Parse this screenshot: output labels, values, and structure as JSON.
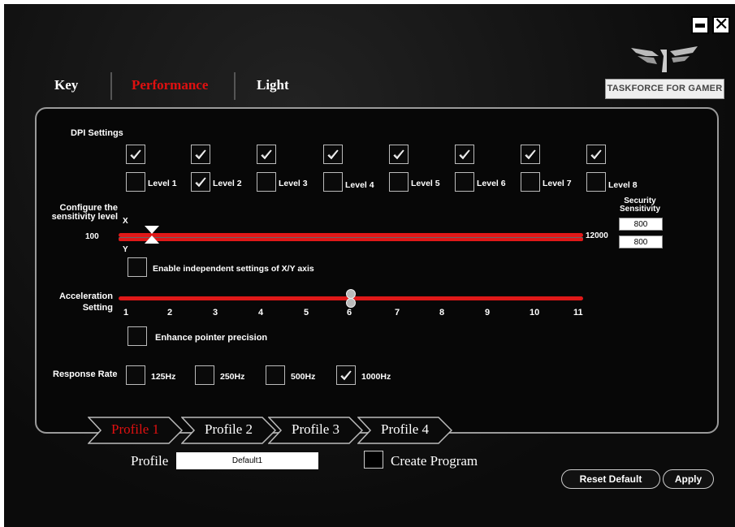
{
  "window_controls": {
    "minimize_icon": "minimize-icon",
    "close_label": "✕"
  },
  "tabs": [
    {
      "label": "Key"
    },
    {
      "label": "Performance"
    },
    {
      "label": "Light"
    }
  ],
  "brand": {
    "text": "TASKFORCE FOR GAMER"
  },
  "dpi": {
    "title": "DPI Settings",
    "enabled": [
      true,
      true,
      true,
      true,
      true,
      true,
      true,
      true
    ],
    "levels": [
      {
        "label": "Level 1",
        "selected": false
      },
      {
        "label": "Level 2",
        "selected": true
      },
      {
        "label": "Level 3",
        "selected": false
      },
      {
        "label": "Level 4",
        "selected": false
      },
      {
        "label": "Level 5",
        "selected": false
      },
      {
        "label": "Level 6",
        "selected": false
      },
      {
        "label": "Level 7",
        "selected": false
      },
      {
        "label": "Level 8",
        "selected": false
      }
    ]
  },
  "sensitivity": {
    "label_line1": "Configure the",
    "label_line2": "sensitivity level",
    "x_label": "X",
    "y_label": "Y",
    "min": "100",
    "max": "12000",
    "security_line1": "Security",
    "security_line2": "Sensitivity",
    "x_value": "800",
    "y_value": "800",
    "independent_label": "Enable independent settings  of X/Y axis",
    "independent_checked": false
  },
  "acceleration": {
    "label_line1": "Acceleration",
    "label_line2": "Setting",
    "ticks": [
      "1",
      "2",
      "3",
      "4",
      "5",
      "6",
      "7",
      "8",
      "9",
      "10",
      "11"
    ],
    "value": 6,
    "enhance_label": "Enhance pointer precision",
    "enhance_checked": false
  },
  "response": {
    "label": "Response Rate",
    "options": [
      {
        "label": "125Hz",
        "checked": false
      },
      {
        "label": "250Hz",
        "checked": false
      },
      {
        "label": "500Hz",
        "checked": false
      },
      {
        "label": "1000Hz",
        "checked": true
      }
    ]
  },
  "profiles": [
    {
      "label": "Profile 1",
      "active": true
    },
    {
      "label": "Profile 2",
      "active": false
    },
    {
      "label": "Profile 3",
      "active": false
    },
    {
      "label": "Profile 4",
      "active": false
    }
  ],
  "profile_row": {
    "label": "Profile",
    "value": "Default1",
    "create_label": "Create Program",
    "create_checked": false
  },
  "buttons": {
    "reset": "Reset Default",
    "apply": "Apply"
  },
  "colors": {
    "accent": "#e01010",
    "background": "#0d0d0d"
  }
}
